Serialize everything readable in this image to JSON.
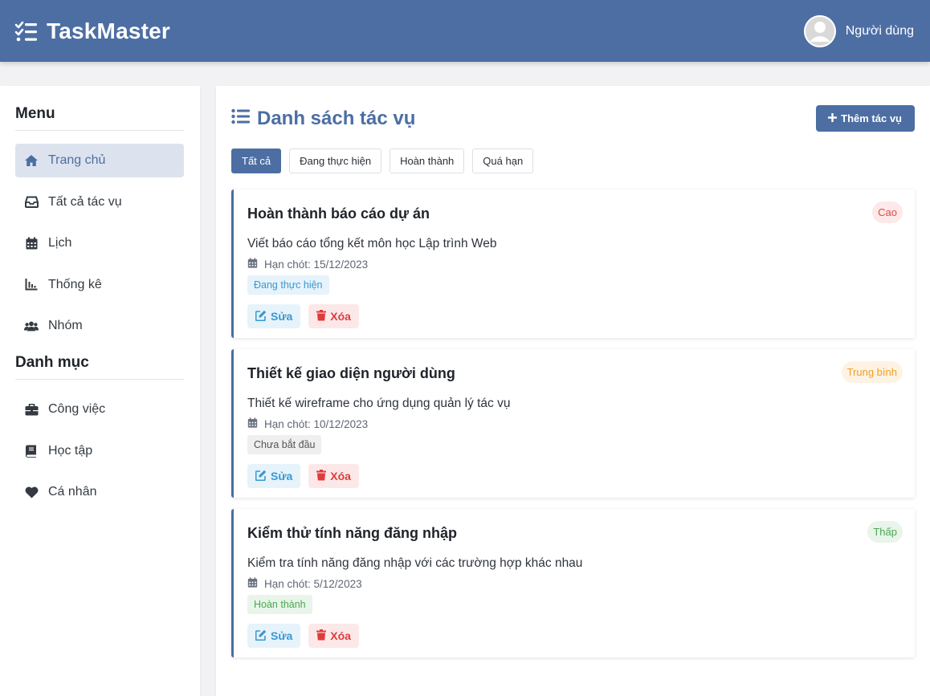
{
  "header": {
    "title": "TaskMaster",
    "user_name": "Người dùng",
    "colors": {
      "bar": "#4c6ea3"
    }
  },
  "sidebar": {
    "menu_heading": "Menu",
    "menu_items": [
      {
        "label": "Trang chủ",
        "icon": "home-icon",
        "active": true
      },
      {
        "label": "Tất cả tác vụ",
        "icon": "inbox-icon",
        "active": false
      },
      {
        "label": "Lịch",
        "icon": "calendar-icon",
        "active": false
      },
      {
        "label": "Thống kê",
        "icon": "chart-icon",
        "active": false
      },
      {
        "label": "Nhóm",
        "icon": "users-icon",
        "active": false
      }
    ],
    "category_heading": "Danh mục",
    "category_items": [
      {
        "label": "Công việc",
        "icon": "briefcase-icon"
      },
      {
        "label": "Học tập",
        "icon": "book-icon"
      },
      {
        "label": "Cá nhân",
        "icon": "heart-icon"
      }
    ]
  },
  "main": {
    "title": "Danh sách tác vụ",
    "add_button": "Thêm tác vụ",
    "filters": [
      {
        "label": "Tất cả",
        "active": true
      },
      {
        "label": "Đang thực hiện",
        "active": false
      },
      {
        "label": "Hoàn thành",
        "active": false
      },
      {
        "label": "Quá hạn",
        "active": false
      }
    ],
    "edit_label": "Sửa",
    "delete_label": "Xóa",
    "tasks": [
      {
        "title": "Hoàn thành báo cáo dự án",
        "priority": "Cao",
        "description": "Viết báo cáo tổng kết môn học Lập trình Web",
        "deadline": "Hạn chót: 15/12/2023",
        "status": "Đang thực hiện"
      },
      {
        "title": "Thiết kế giao diện người dùng",
        "priority": "Trung bình",
        "description": "Thiết kế wireframe cho ứng dụng quản lý tác vụ",
        "deadline": "Hạn chót: 10/12/2023",
        "status": "Chưa bắt đầu"
      },
      {
        "title": "Kiểm thử tính năng đăng nhập",
        "priority": "Thấp",
        "description": "Kiểm tra tính năng đăng nhập với các trường hợp khác nhau",
        "deadline": "Hạn chót: 5/12/2023",
        "status": "Hoàn thành"
      }
    ]
  }
}
